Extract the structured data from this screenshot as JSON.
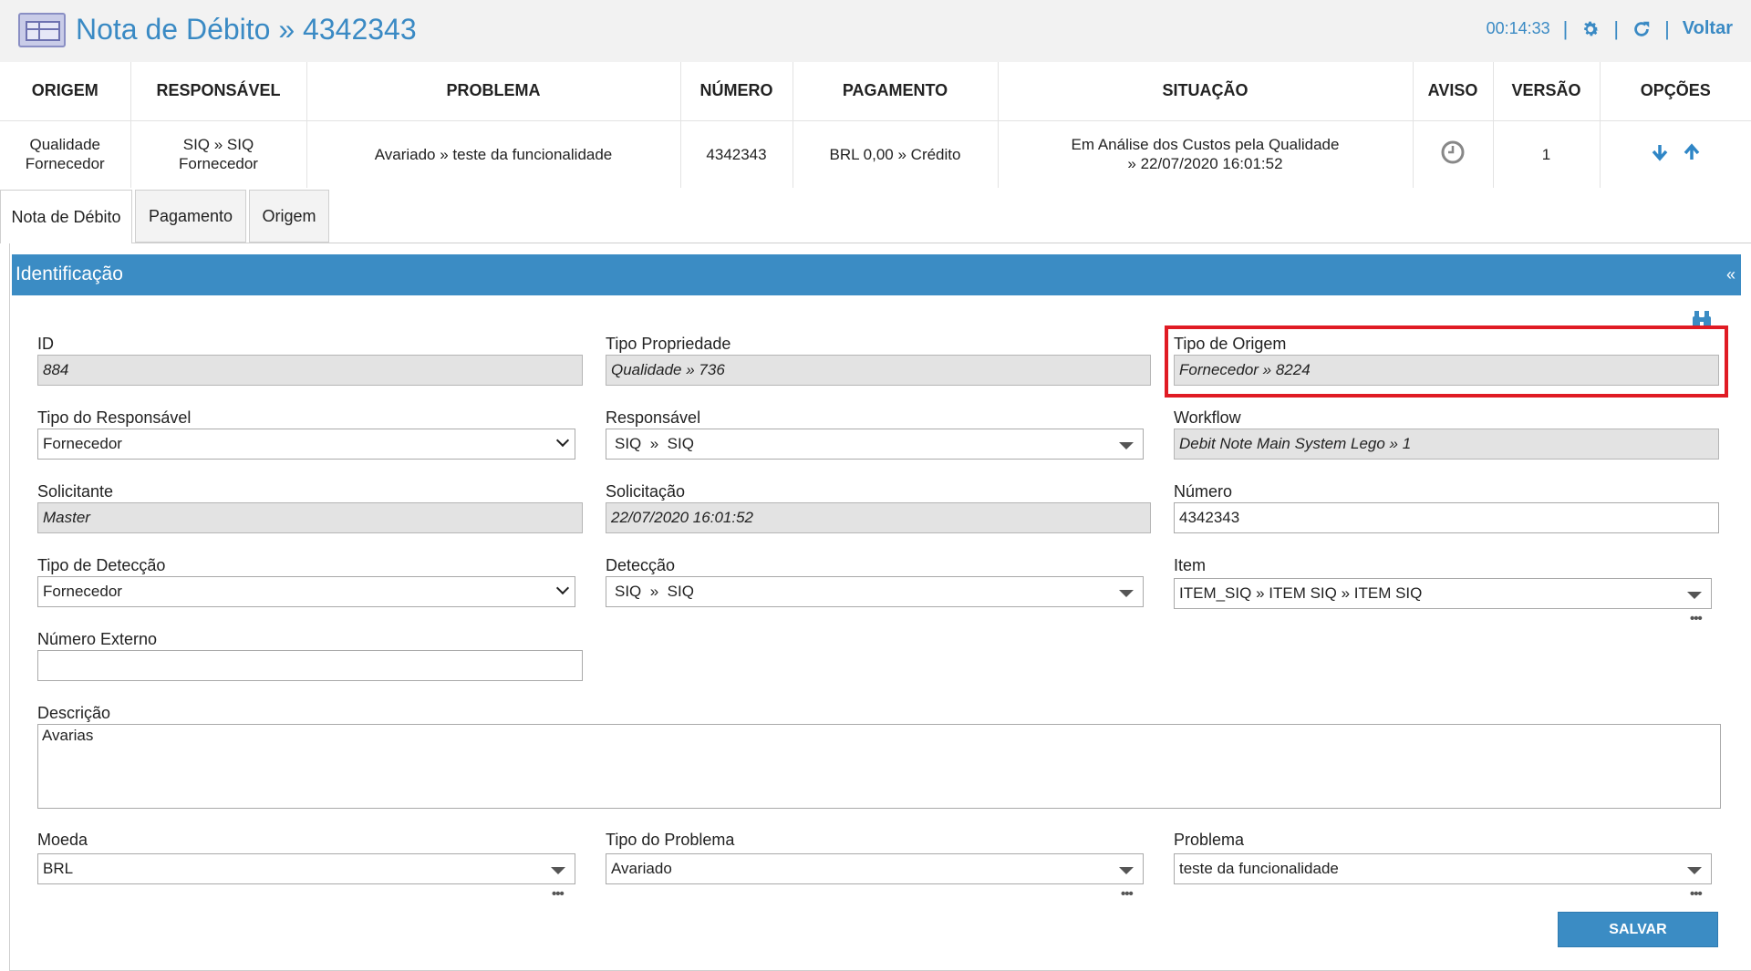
{
  "header": {
    "title": "Nota de Débito » 4342343",
    "timer": "00:14:33",
    "separator": "|",
    "back_label": "Voltar"
  },
  "summary": {
    "headers": [
      "ORIGEM",
      "RESPONSÁVEL",
      "PROBLEMA",
      "NÚMERO",
      "PAGAMENTO",
      "SITUAÇÃO",
      "AVISO",
      "VERSÃO",
      "OPÇÕES"
    ],
    "row": {
      "origem_1": "Qualidade",
      "origem_2": "Fornecedor",
      "responsavel_1": "SIQ » SIQ",
      "responsavel_2": "Fornecedor",
      "problema": "Avariado » teste da funcionalidade",
      "numero": "4342343",
      "pagamento": "BRL 0,00 » Crédito",
      "situacao_1": "Em Análise dos Custos pela Qualidade",
      "situacao_2": "» 22/07/2020 16:01:52",
      "aviso_icon": "clock-icon",
      "versao": "1",
      "opcoes_icons": [
        "arrow-down-icon",
        "arrow-up-icon"
      ]
    }
  },
  "tabs": [
    "Nota de Débito",
    "Pagamento",
    "Origem"
  ],
  "panel": {
    "title": "Identificação",
    "collapse": "«"
  },
  "fields": {
    "id": {
      "label": "ID",
      "value": "884"
    },
    "tipo_propriedade": {
      "label": "Tipo Propriedade",
      "value": "Qualidade » 736"
    },
    "tipo_origem": {
      "label": "Tipo de Origem",
      "value": "Fornecedor » 8224"
    },
    "tipo_responsavel": {
      "label": "Tipo do Responsável",
      "value": "Fornecedor"
    },
    "responsavel": {
      "label": "Responsável",
      "value": "SIQ  »  SIQ"
    },
    "workflow": {
      "label": "Workflow",
      "value": "Debit Note Main System Lego » 1"
    },
    "solicitante": {
      "label": "Solicitante",
      "value": "Master"
    },
    "solicitacao": {
      "label": "Solicitação",
      "value": "22/07/2020 16:01:52"
    },
    "numero": {
      "label": "Número",
      "value": "4342343"
    },
    "tipo_deteccao": {
      "label": "Tipo de Detecção",
      "value": "Fornecedor"
    },
    "deteccao": {
      "label": "Detecção",
      "value": "SIQ  »  SIQ"
    },
    "item": {
      "label": "Item",
      "value": "ITEM_SIQ » ITEM SIQ » ITEM SIQ"
    },
    "numero_externo": {
      "label": "Número Externo",
      "value": ""
    },
    "descricao": {
      "label": "Descrição",
      "value": "Avarias"
    },
    "moeda": {
      "label": "Moeda",
      "value": "BRL"
    },
    "tipo_problema": {
      "label": "Tipo do Problema",
      "value": "Avariado"
    },
    "problema": {
      "label": "Problema",
      "value": "teste da funcionalidade"
    }
  },
  "dots": "•••",
  "save_label": "SALVAR",
  "colors": {
    "accent": "#3b8cc4",
    "highlight": "#e01b24"
  }
}
